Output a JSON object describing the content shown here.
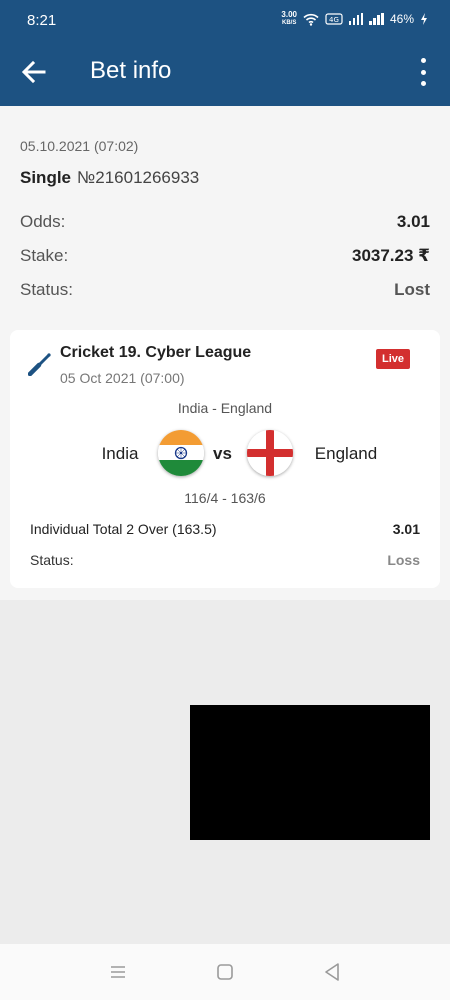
{
  "status_bar": {
    "time": "8:21",
    "net_speed_value": "3.00",
    "net_speed_unit": "KB/S",
    "battery": "46%"
  },
  "app_bar": {
    "title": "Bet info",
    "back_icon": "arrow-left-icon",
    "menu_icon": "more-vert-icon"
  },
  "bet": {
    "date": "05.10.2021 (07:02)",
    "type": "Single",
    "number": "№21601266933",
    "odds_label": "Odds:",
    "odds_value": "3.01",
    "stake_label": "Stake:",
    "stake_value": "3037.23 ₹",
    "status_label": "Status:",
    "status_value": "Lost"
  },
  "event": {
    "sport_icon": "cricket-bat-icon",
    "league": "Cricket 19. Cyber League",
    "date": "05 Oct 2021 (07:00)",
    "live_badge": "Live",
    "match": "India - England",
    "team1": "India",
    "team2": "England",
    "vs": "vs",
    "score": "116/4 - 163/6",
    "market": "Individual Total 2 Over (163.5)",
    "market_odds": "3.01",
    "status_label": "Status:",
    "status_value": "Loss"
  },
  "nav_bar": {
    "menu_icon": "recent-apps-icon",
    "home_icon": "home-icon",
    "back_icon": "back-triangle-icon"
  },
  "colors": {
    "header": "#1d5282",
    "live": "#d32f2f",
    "background": "#ececec"
  }
}
